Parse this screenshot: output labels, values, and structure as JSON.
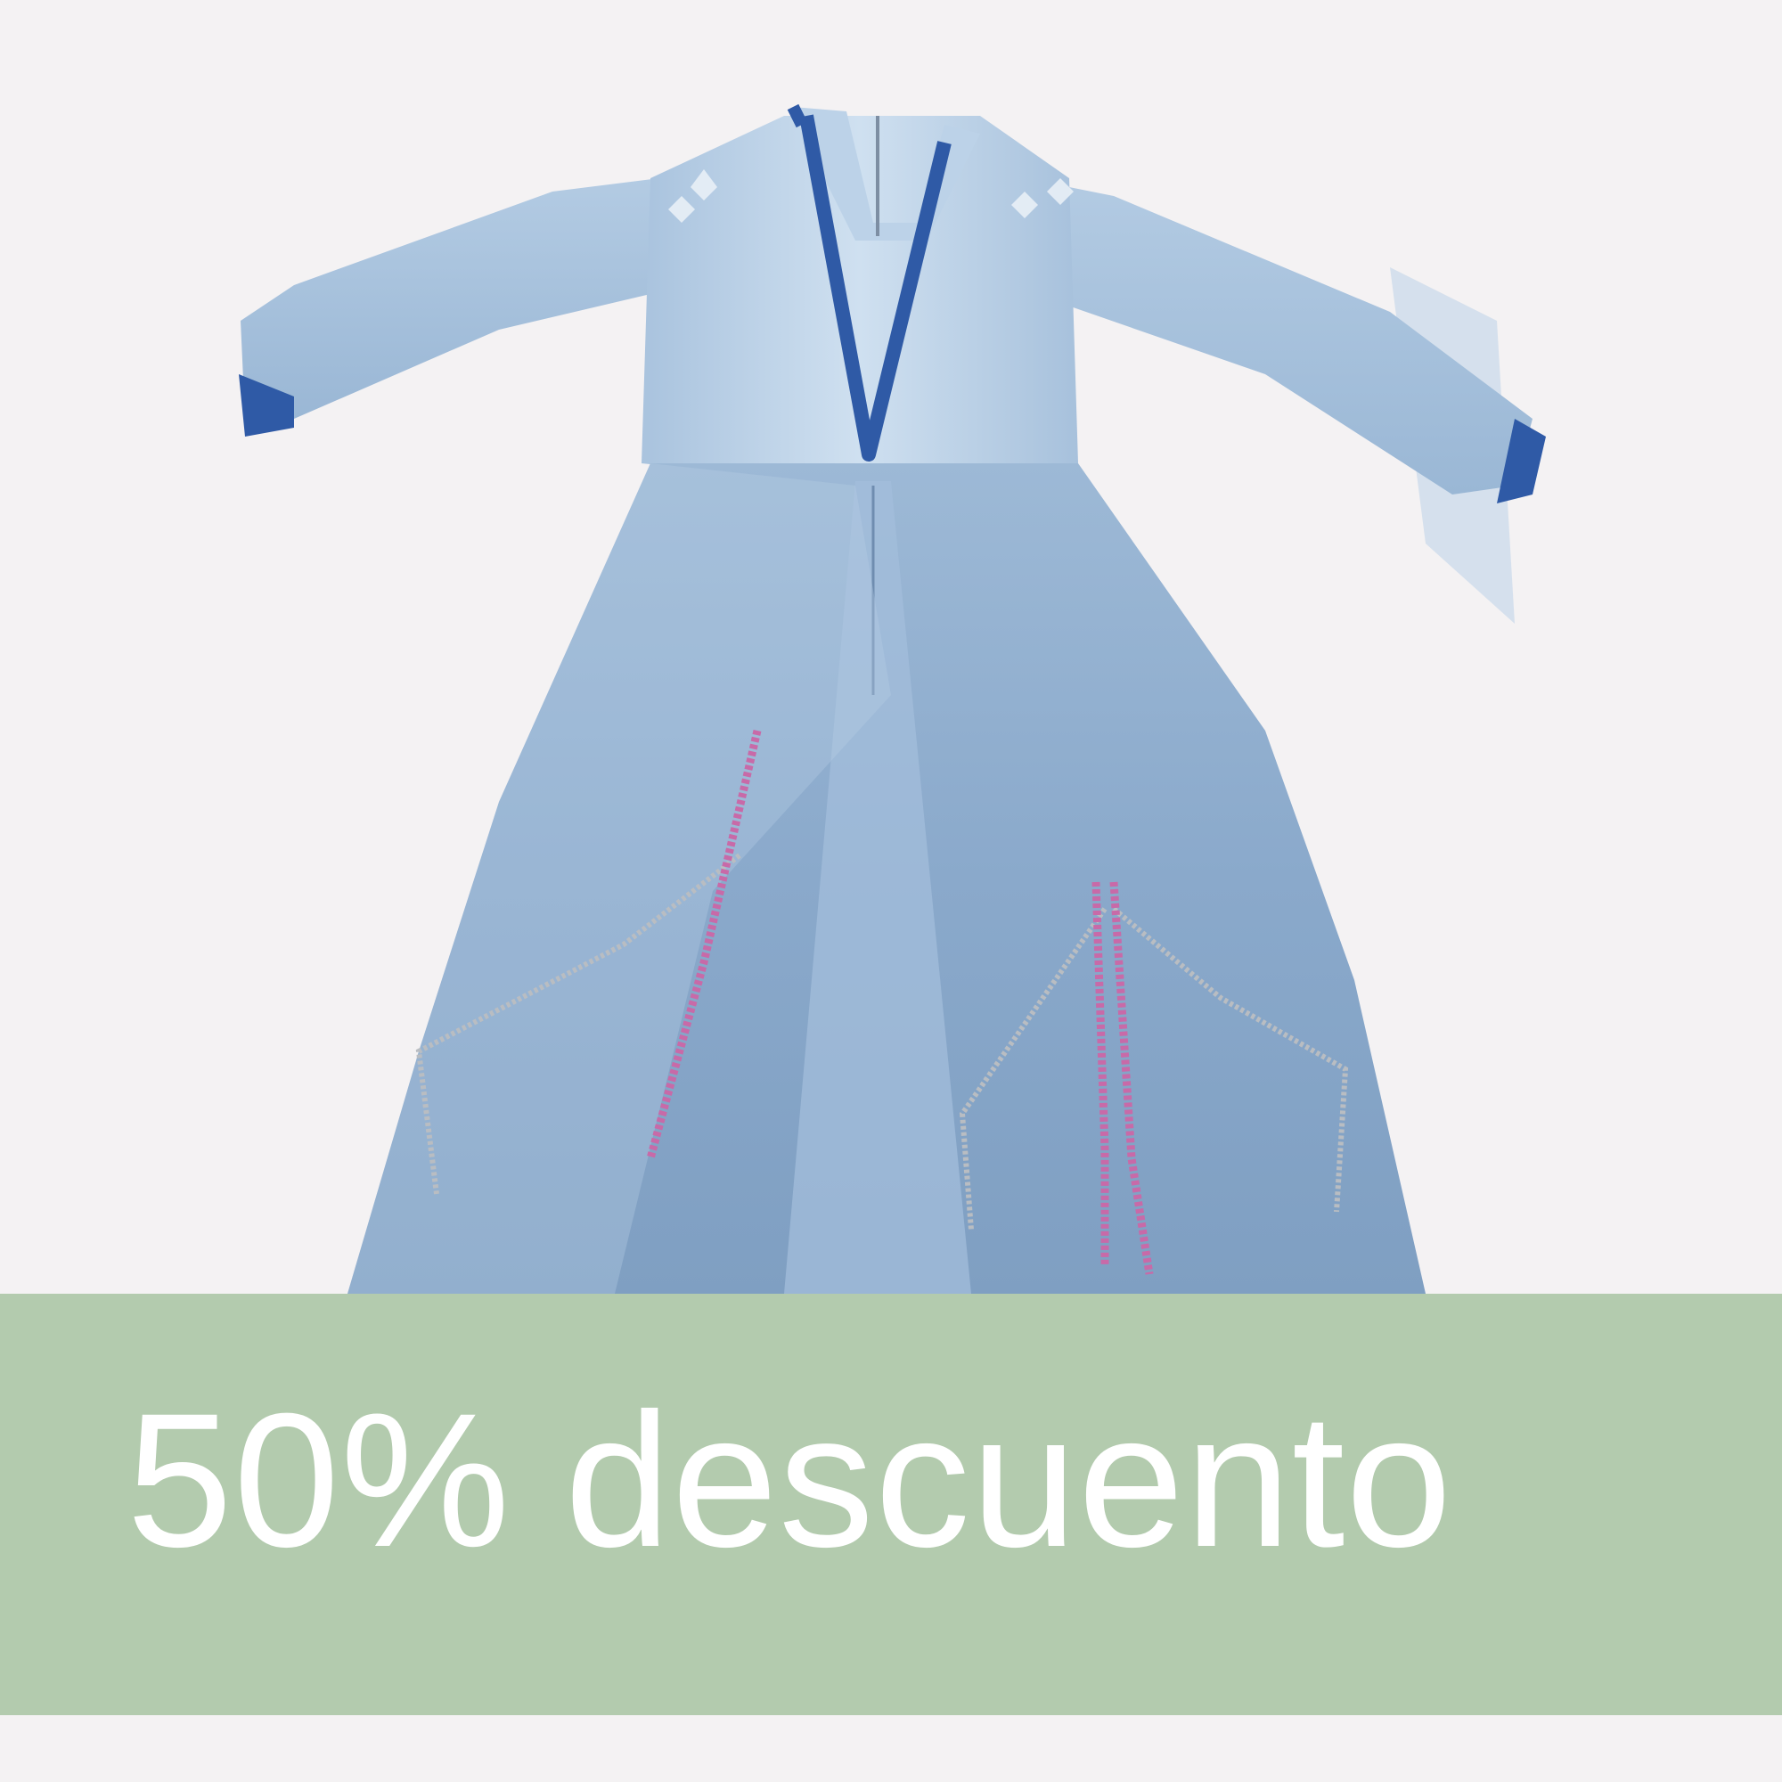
{
  "product": {
    "image_alt": "dress-photo",
    "dress_color": "#8fb0cf",
    "trim_color": "#2f5aa6",
    "glitter_pink": "#c86aa8",
    "glitter_silver": "#b9bdc2"
  },
  "banner": {
    "text": "50% descuento",
    "background_color": "#b3cbae",
    "text_color": "#ffffff"
  }
}
